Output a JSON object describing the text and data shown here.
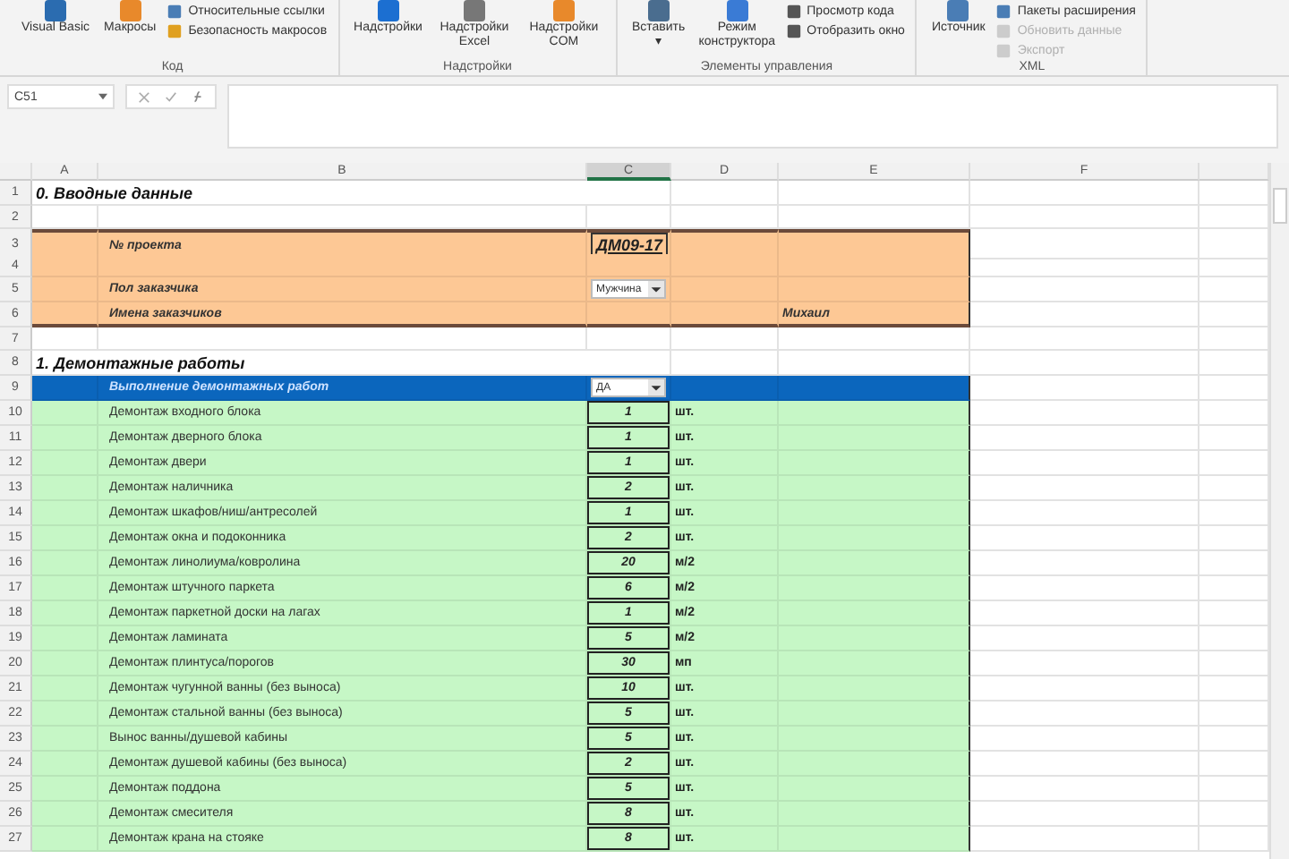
{
  "ribbon": {
    "groups": [
      {
        "label": "Код",
        "items": [
          {
            "kind": "big",
            "label": "Visual Basic",
            "disabled": false
          },
          {
            "kind": "big",
            "label": "Макросы",
            "disabled": false
          },
          {
            "kind": "small",
            "label": "Относительные ссылки",
            "disabled": false
          },
          {
            "kind": "small",
            "label": "Безопасность макросов",
            "disabled": false
          }
        ]
      },
      {
        "label": "Надстройки",
        "items": [
          {
            "kind": "big",
            "label": "Надстройки",
            "disabled": false
          },
          {
            "kind": "big",
            "label": "Надстройки Excel",
            "disabled": false
          },
          {
            "kind": "big",
            "label": "Надстройки COM",
            "disabled": false
          }
        ]
      },
      {
        "label": "Элементы управления",
        "items": [
          {
            "kind": "big",
            "label": "Вставить",
            "disabled": false,
            "caret": "▾"
          },
          {
            "kind": "big",
            "label": "Режим конструктора",
            "disabled": false
          },
          {
            "kind": "small",
            "label": "Просмотр кода",
            "disabled": false
          },
          {
            "kind": "small",
            "label": "Отобразить окно",
            "disabled": false
          }
        ]
      },
      {
        "label": "XML",
        "items": [
          {
            "kind": "big",
            "label": "Источник",
            "disabled": false
          },
          {
            "kind": "small",
            "label": "Пакеты расширения",
            "disabled": false
          },
          {
            "kind": "small",
            "label": "Обновить данные",
            "disabled": true
          },
          {
            "kind": "small",
            "label": "Экспорт",
            "disabled": true
          }
        ]
      }
    ]
  },
  "formula_bar": {
    "name_box": "C51"
  },
  "columns": [
    {
      "label": "A",
      "selected": false
    },
    {
      "label": "B",
      "selected": false
    },
    {
      "label": "C",
      "selected": true
    },
    {
      "label": "D",
      "selected": false
    },
    {
      "label": "E",
      "selected": false
    },
    {
      "label": "F",
      "selected": false
    }
  ],
  "rows": [
    {
      "number": "1",
      "kind": "title",
      "label": "0. Вводные данные"
    },
    {
      "number": "2",
      "kind": "blank"
    },
    {
      "number": "3",
      "kind": "orange",
      "label": "№ проекта",
      "value": "ДМ09-17"
    },
    {
      "number": "4",
      "kind": "orange"
    },
    {
      "number": "5",
      "kind": "orange",
      "label": "Пол заказчика",
      "dropdown": "Мужчина"
    },
    {
      "number": "6",
      "kind": "orange",
      "label": "Имена заказчиков",
      "note": "Михаил"
    },
    {
      "number": "7",
      "kind": "blank"
    },
    {
      "number": "8",
      "kind": "title",
      "label": "1. Демонтажные работы"
    },
    {
      "number": "9",
      "kind": "header",
      "label": "Выполнение демонтажных работ",
      "dropdown": "ДА"
    },
    {
      "number": "10",
      "kind": "item",
      "label": "Демонтаж входного блока",
      "qty": "1",
      "unit": "шт."
    },
    {
      "number": "11",
      "kind": "item",
      "label": "Демонтаж дверного блока",
      "qty": "1",
      "unit": "шт."
    },
    {
      "number": "12",
      "kind": "item",
      "label": "Демонтаж двери",
      "qty": "1",
      "unit": "шт."
    },
    {
      "number": "13",
      "kind": "item",
      "label": "Демонтаж наличника",
      "qty": "2",
      "unit": "шт."
    },
    {
      "number": "14",
      "kind": "item",
      "label": "Демонтаж шкафов/ниш/антресолей",
      "qty": "1",
      "unit": "шт."
    },
    {
      "number": "15",
      "kind": "item",
      "label": "Демонтаж окна и подоконника",
      "qty": "2",
      "unit": "шт."
    },
    {
      "number": "16",
      "kind": "item",
      "label": "Демонтаж линолиума/ковролина",
      "qty": "20",
      "unit": "м/2"
    },
    {
      "number": "17",
      "kind": "item",
      "label": "Демонтаж штучного паркета",
      "qty": "6",
      "unit": "м/2"
    },
    {
      "number": "18",
      "kind": "item",
      "label": "Демонтаж паркетной доски на лагах",
      "qty": "1",
      "unit": "м/2"
    },
    {
      "number": "19",
      "kind": "item",
      "label": "Демонтаж ламината",
      "qty": "5",
      "unit": "м/2"
    },
    {
      "number": "20",
      "kind": "item",
      "label": "Демонтаж плинтуса/порогов",
      "qty": "30",
      "unit": "мп"
    },
    {
      "number": "21",
      "kind": "item",
      "label": "Демонтаж чугунной ванны (без выноса)",
      "qty": "10",
      "unit": "шт."
    },
    {
      "number": "22",
      "kind": "item",
      "label": "Демонтаж стальной ванны (без выноса)",
      "qty": "5",
      "unit": "шт."
    },
    {
      "number": "23",
      "kind": "item",
      "label": "Вынос ванны/душевой кабины",
      "qty": "5",
      "unit": "шт."
    },
    {
      "number": "24",
      "kind": "item",
      "label": "Демонтаж душевой кабины (без выноса)",
      "qty": "2",
      "unit": "шт."
    },
    {
      "number": "25",
      "kind": "item",
      "label": "Демонтаж поддона",
      "qty": "5",
      "unit": "шт."
    },
    {
      "number": "26",
      "kind": "item",
      "label": "Демонтаж смесителя",
      "qty": "8",
      "unit": "шт."
    },
    {
      "number": "27",
      "kind": "item",
      "label": "Демонтаж крана на стояке",
      "qty": "8",
      "unit": "шт."
    }
  ]
}
